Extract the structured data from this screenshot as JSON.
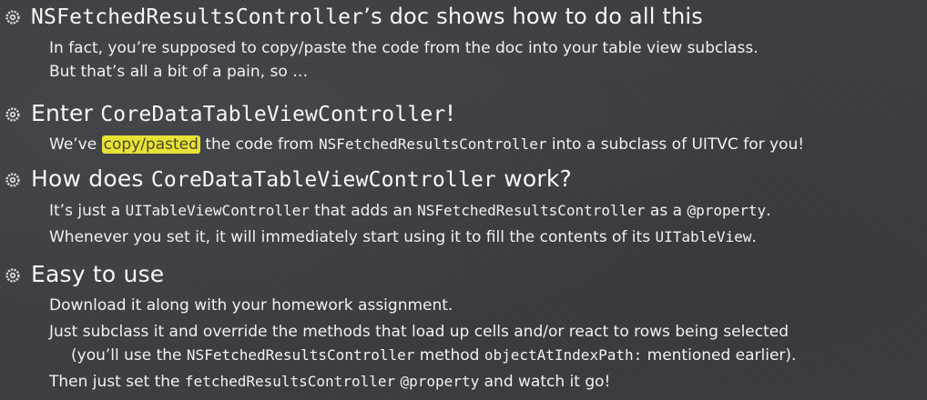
{
  "bullets": [
    {
      "heading": {
        "code": "NSFetchedResultsController",
        "text": "’s doc shows how to do all this"
      },
      "lines": [
        {
          "t1": "In fact, you’re supposed to copy/paste the code from the doc into your table view subclass."
        },
        {
          "t1": "But that’s all a bit of a pain, so …"
        }
      ]
    },
    {
      "heading": {
        "text": "Enter ",
        "code": "CoreDataTableViewController",
        "text2": "!"
      },
      "lines": [
        {
          "t1": "We’ve ",
          "hl": "copy/pasted",
          "t2": " the code from ",
          "c1": "NSFetchedResultsController",
          "t3": " into a subclass of UITVC for you!"
        }
      ]
    },
    {
      "heading": {
        "text": "How does ",
        "code": "CoreDataTableViewController",
        "text2": " work?"
      },
      "lines": [
        {
          "t1": "It’s just a ",
          "c1": "UITableViewController",
          "t2": " that adds an ",
          "c2": "NSFetchedResultsController",
          "t3": " as a ",
          "c3": "@property",
          "t4": "."
        },
        {
          "t1": "Whenever you set it, it will immediately start using it to fill the contents of its ",
          "c1": "UITableView",
          "t2": "."
        }
      ]
    },
    {
      "heading": {
        "text": "Easy to use"
      },
      "lines": [
        {
          "t1": "Download it along with your homework assignment."
        },
        {
          "t1": "Just subclass it and override the methods that load up cells and/or react to rows being selected"
        },
        {
          "t1": "(you’ll use the ",
          "c1": "NSFetchedResultsController",
          "t2": " method ",
          "c2": "objectAtIndexPath:",
          "t3": " mentioned earlier)."
        },
        {
          "t1": "Then just set the ",
          "c1": "fetchedResultsController",
          "t2": " ",
          "c2": "@property",
          "t3": " and watch it go!"
        }
      ]
    }
  ],
  "colors": {
    "background": "#3b3d41",
    "text": "#f4f4f4",
    "highlight": "#e7e236"
  },
  "icons": {
    "bullet": "gear-bullet-icon"
  }
}
